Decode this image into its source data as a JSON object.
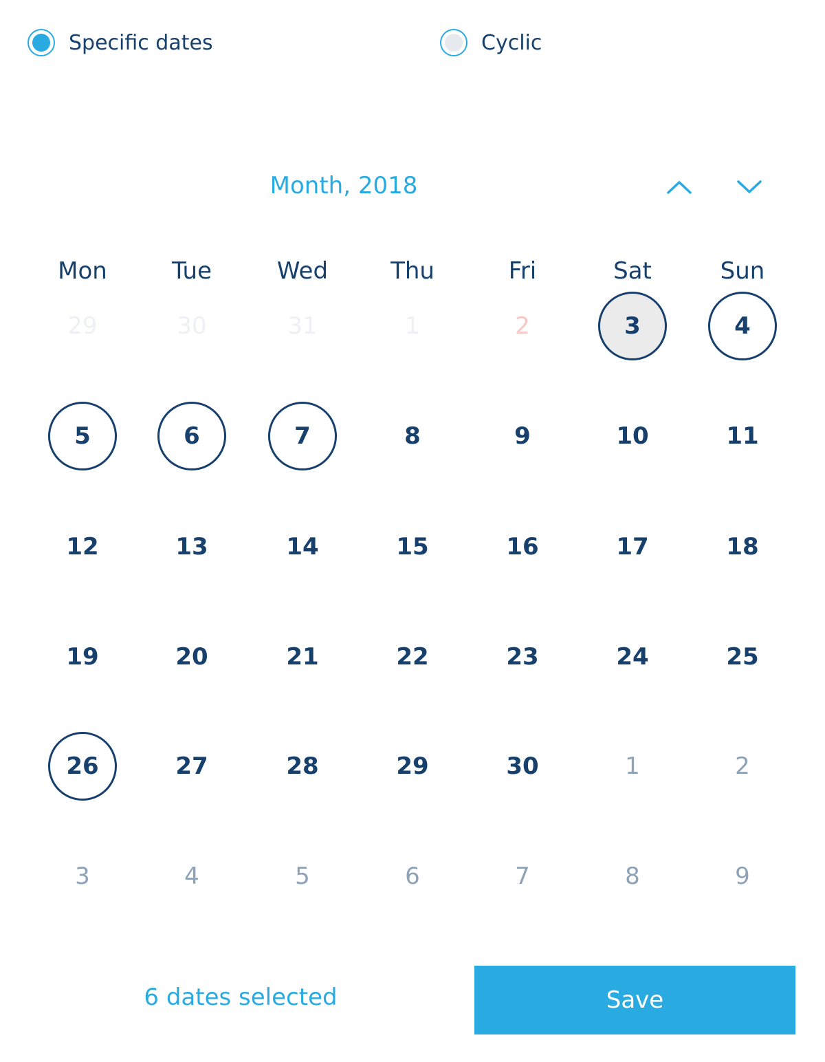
{
  "mode_options": {
    "specific": {
      "label": "Specific dates",
      "checked": true
    },
    "cyclic": {
      "label": "Cyclic",
      "checked": false
    }
  },
  "calendar": {
    "title": "Month, 2018",
    "prev_icon": "chevron-up-icon",
    "next_icon": "chevron-down-icon",
    "weekdays": [
      "Mon",
      "Tue",
      "Wed",
      "Thu",
      "Fri",
      "Sat",
      "Sun"
    ],
    "weeks": [
      [
        {
          "label": "29",
          "state": "faint"
        },
        {
          "label": "30",
          "state": "faint"
        },
        {
          "label": "31",
          "state": "faint"
        },
        {
          "label": "1",
          "state": "faint"
        },
        {
          "label": "2",
          "state": "faint-red"
        },
        {
          "label": "3",
          "state": "today-selected"
        },
        {
          "label": "4",
          "state": "selected"
        }
      ],
      [
        {
          "label": "5",
          "state": "selected"
        },
        {
          "label": "6",
          "state": "selected"
        },
        {
          "label": "7",
          "state": "selected"
        },
        {
          "label": "8",
          "state": "normal"
        },
        {
          "label": "9",
          "state": "normal"
        },
        {
          "label": "10",
          "state": "normal"
        },
        {
          "label": "11",
          "state": "normal"
        }
      ],
      [
        {
          "label": "12",
          "state": "normal"
        },
        {
          "label": "13",
          "state": "normal"
        },
        {
          "label": "14",
          "state": "normal"
        },
        {
          "label": "15",
          "state": "normal"
        },
        {
          "label": "16",
          "state": "normal"
        },
        {
          "label": "17",
          "state": "normal"
        },
        {
          "label": "18",
          "state": "normal"
        }
      ],
      [
        {
          "label": "19",
          "state": "normal"
        },
        {
          "label": "20",
          "state": "normal"
        },
        {
          "label": "21",
          "state": "normal"
        },
        {
          "label": "22",
          "state": "normal"
        },
        {
          "label": "23",
          "state": "normal"
        },
        {
          "label": "24",
          "state": "normal"
        },
        {
          "label": "25",
          "state": "normal"
        }
      ],
      [
        {
          "label": "26",
          "state": "selected"
        },
        {
          "label": "27",
          "state": "normal"
        },
        {
          "label": "28",
          "state": "normal"
        },
        {
          "label": "29",
          "state": "normal"
        },
        {
          "label": "30",
          "state": "normal"
        },
        {
          "label": "1",
          "state": "muted"
        },
        {
          "label": "2",
          "state": "muted"
        }
      ],
      [
        {
          "label": "3",
          "state": "muted"
        },
        {
          "label": "4",
          "state": "muted"
        },
        {
          "label": "5",
          "state": "muted"
        },
        {
          "label": "6",
          "state": "muted"
        },
        {
          "label": "7",
          "state": "muted"
        },
        {
          "label": "8",
          "state": "muted"
        },
        {
          "label": "9",
          "state": "muted"
        }
      ]
    ]
  },
  "footer": {
    "selected_count": "6 dates selected",
    "save_label": "Save"
  },
  "colors": {
    "accent": "#29abe2",
    "primary_text": "#17406d",
    "muted_text": "#8ea2b8",
    "today_bg": "#ebebeb"
  }
}
